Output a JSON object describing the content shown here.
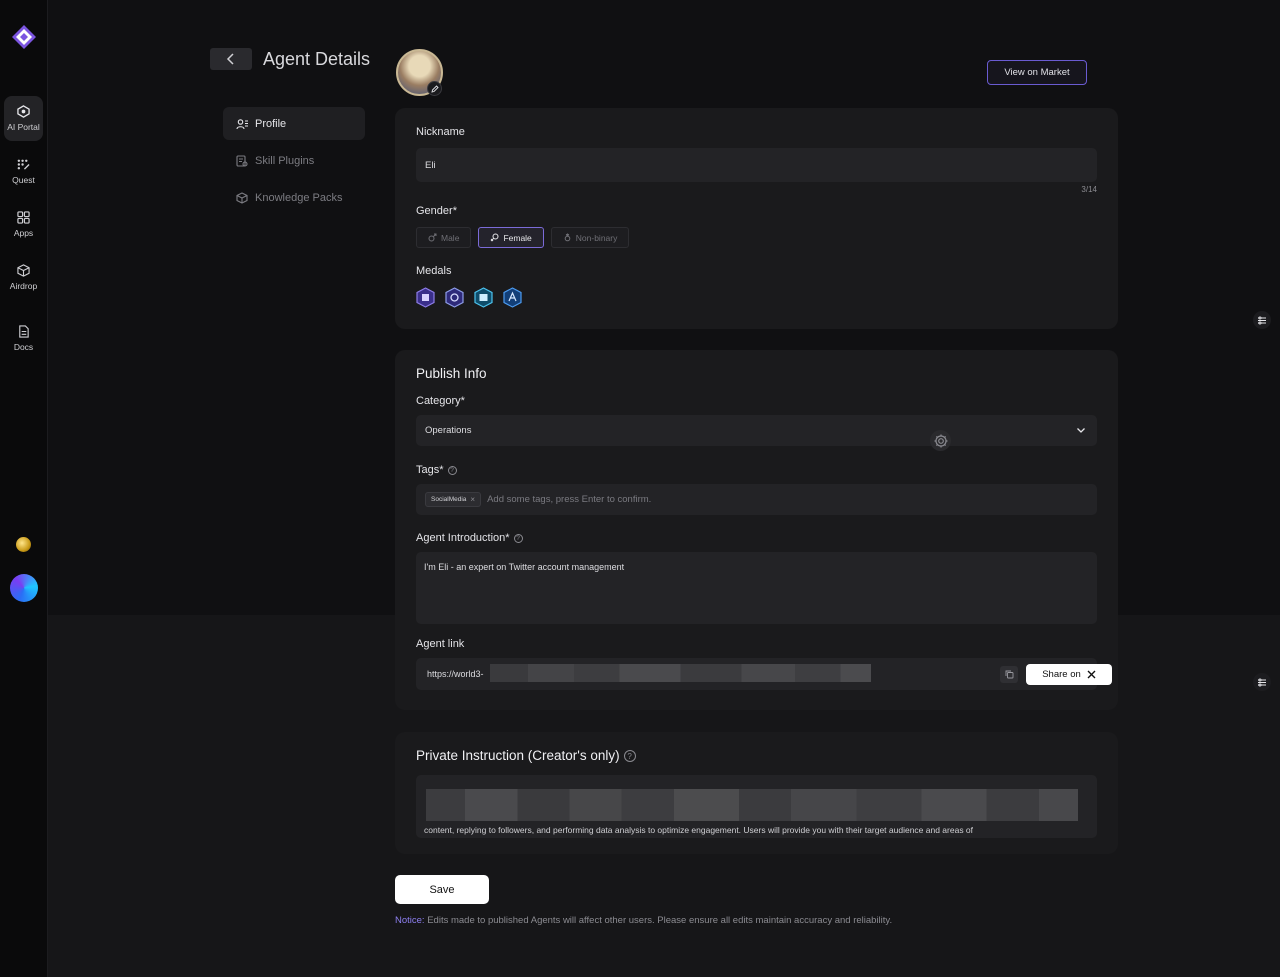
{
  "rail": {
    "items": [
      {
        "label": "AI Portal",
        "icon": "portal-icon"
      },
      {
        "label": "Quest",
        "icon": "quest-icon"
      },
      {
        "label": "Apps",
        "icon": "apps-icon"
      },
      {
        "label": "Airdrop",
        "icon": "airdrop-icon"
      },
      {
        "label": "Docs",
        "icon": "docs-icon"
      }
    ]
  },
  "header": {
    "title": "Agent Details",
    "view_market": "View on Market"
  },
  "side_nav": {
    "items": [
      {
        "label": "Profile"
      },
      {
        "label": "Skill Plugins"
      },
      {
        "label": "Knowledge Packs"
      }
    ]
  },
  "profile": {
    "nickname_label": "Nickname",
    "nickname_value": "Eli",
    "nickname_counter": "3/14",
    "gender_label": "Gender*",
    "genders": [
      "Male",
      "Female",
      "Non-binary"
    ],
    "selected_gender": "Female",
    "medals_label": "Medals"
  },
  "publish": {
    "title": "Publish Info",
    "category_label": "Category*",
    "category_value": "Operations",
    "tags_label": "Tags*",
    "tag_chip": "SocialMedia",
    "tags_placeholder": "Add some tags, press Enter to confirm.",
    "intro_label": "Agent Introduction*",
    "intro_value": "I'm Eli - an expert on Twitter account management",
    "link_label": "Agent link",
    "link_value": "https://world3-",
    "share_label": "Share on"
  },
  "private": {
    "title": "Private Instruction (Creator's only)",
    "visible_text": "content, replying to followers, and performing data analysis to optimize engagement. Users will provide you with their target audience and areas of"
  },
  "footer": {
    "save": "Save",
    "notice_tag": "Notice:",
    "notice_text": " Edits made to published Agents will affect other users. Please ensure all edits maintain accuracy and reliability."
  },
  "colors": {
    "accent": "#7b6bd8",
    "background": "#101012",
    "card": "#1a1a1c"
  }
}
